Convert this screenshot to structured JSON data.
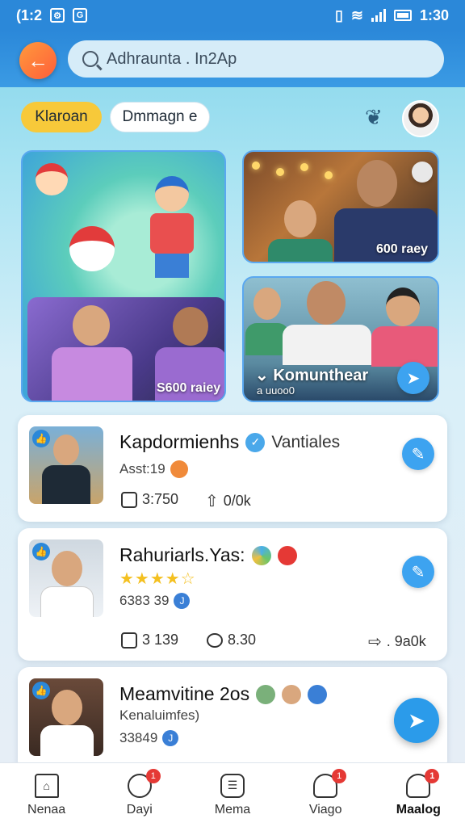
{
  "status_bar": {
    "left_text": "(1:2",
    "time": "1:30"
  },
  "header": {
    "search_text": "Adhraunta . In2Ap"
  },
  "chips": [
    {
      "label": "Klaroan"
    },
    {
      "label": "Dmmagn e"
    }
  ],
  "featured": {
    "tile_2_label": "600 raey",
    "tile_1_label": "S600 raiey",
    "tile_3_label": "Komunthear",
    "tile_3_sub": "a uuoo0"
  },
  "cards": [
    {
      "title": "Kapdormienhs",
      "tag": "Vantiales",
      "subtitle": "Asst:19",
      "stat_1": "3:750",
      "stat_2": "0/0k"
    },
    {
      "title": "Rahuriarls.Yas:",
      "rating": 4.5,
      "subtitle": "6383 39",
      "stat_1": "3 139",
      "stat_2": "8.30",
      "stat_3": ". 9a0k"
    },
    {
      "title": "Meamvitine 2os",
      "subtitle": "Kenaluimfes)",
      "meta": "33849"
    }
  ],
  "bottom_nav": [
    {
      "label": "Nenaa",
      "icon": "home-icon"
    },
    {
      "label": "Dayi",
      "icon": "search-icon",
      "badge": "1"
    },
    {
      "label": "Mema",
      "icon": "menu-icon"
    },
    {
      "label": "Viago",
      "icon": "user-icon",
      "badge": "1"
    },
    {
      "label": "Maalog",
      "icon": "profile-icon",
      "badge": "1"
    }
  ],
  "colors": {
    "primary": "#2b88d9",
    "accent": "#f7c93a",
    "badge": "#e53935"
  }
}
